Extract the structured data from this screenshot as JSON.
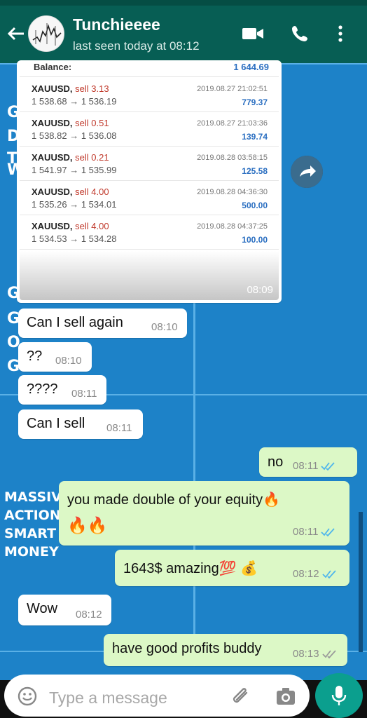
{
  "header": {
    "contact_name": "Tunchieeee",
    "last_seen": "last seen today at 08:12",
    "icons": [
      "back-arrow-icon",
      "video-call-icon",
      "phone-icon",
      "more-vert-icon"
    ]
  },
  "wallpaper": {
    "letters_left": [
      "G",
      "D",
      "T",
      "W",
      "G",
      "G",
      "O",
      "G"
    ],
    "promo_lines": [
      "MASSIV",
      "ACTION",
      "SMART",
      "MONEY"
    ]
  },
  "image_message": {
    "balance_label": "Balance:",
    "balance_value": "1 644.69",
    "time": "08:09",
    "trades": [
      {
        "symbol": "XAUUSD,",
        "side": "sell 3.13",
        "prices": "1 538.68 → 1 536.19",
        "datetime": "2019.08.27 21:02:51",
        "profit": "779.37"
      },
      {
        "symbol": "XAUUSD,",
        "side": "sell 0.51",
        "prices": "1 538.82 → 1 536.08",
        "datetime": "2019.08.27 21:03:36",
        "profit": "139.74"
      },
      {
        "symbol": "XAUUSD,",
        "side": "sell 0.21",
        "prices": "1 541.97 → 1 535.99",
        "datetime": "2019.08.28 03:58:15",
        "profit": "125.58"
      },
      {
        "symbol": "XAUUSD,",
        "side": "sell 4.00",
        "prices": "1 535.26 → 1 534.01",
        "datetime": "2019.08.28 04:36:30",
        "profit": "500.00"
      },
      {
        "symbol": "XAUUSD,",
        "side": "sell 4.00",
        "prices": "1 534.53 → 1 534.28",
        "datetime": "2019.08.28 04:37:25",
        "profit": "100.00"
      }
    ]
  },
  "messages": [
    {
      "dir": "in",
      "text": "Can I sell again",
      "time": "08:10"
    },
    {
      "dir": "in",
      "text": "??",
      "time": "08:10"
    },
    {
      "dir": "in",
      "text": "????",
      "time": "08:11"
    },
    {
      "dir": "in",
      "text": "Can I sell",
      "time": "08:11"
    },
    {
      "dir": "out",
      "text": "no",
      "time": "08:11",
      "status": "read"
    },
    {
      "dir": "out",
      "text": "you made double of your equity🔥",
      "text2": "🔥🔥",
      "time": "08:11",
      "status": "read"
    },
    {
      "dir": "out",
      "text": "1643$ amazing💯 💰",
      "time": "08:12",
      "status": "read"
    },
    {
      "dir": "in",
      "text": "Wow",
      "time": "08:12"
    },
    {
      "dir": "out",
      "text": "have good profits buddy",
      "time": "08:13",
      "status": "delivered"
    }
  ],
  "input": {
    "placeholder": "Type a message"
  },
  "colors": {
    "header": "#075e54",
    "wallpaper": "#1d82c8",
    "outgoing": "#dcf8c6",
    "incoming": "#ffffff",
    "read_tick": "#4fb6ec",
    "mic_button": "#0b9f8e"
  }
}
